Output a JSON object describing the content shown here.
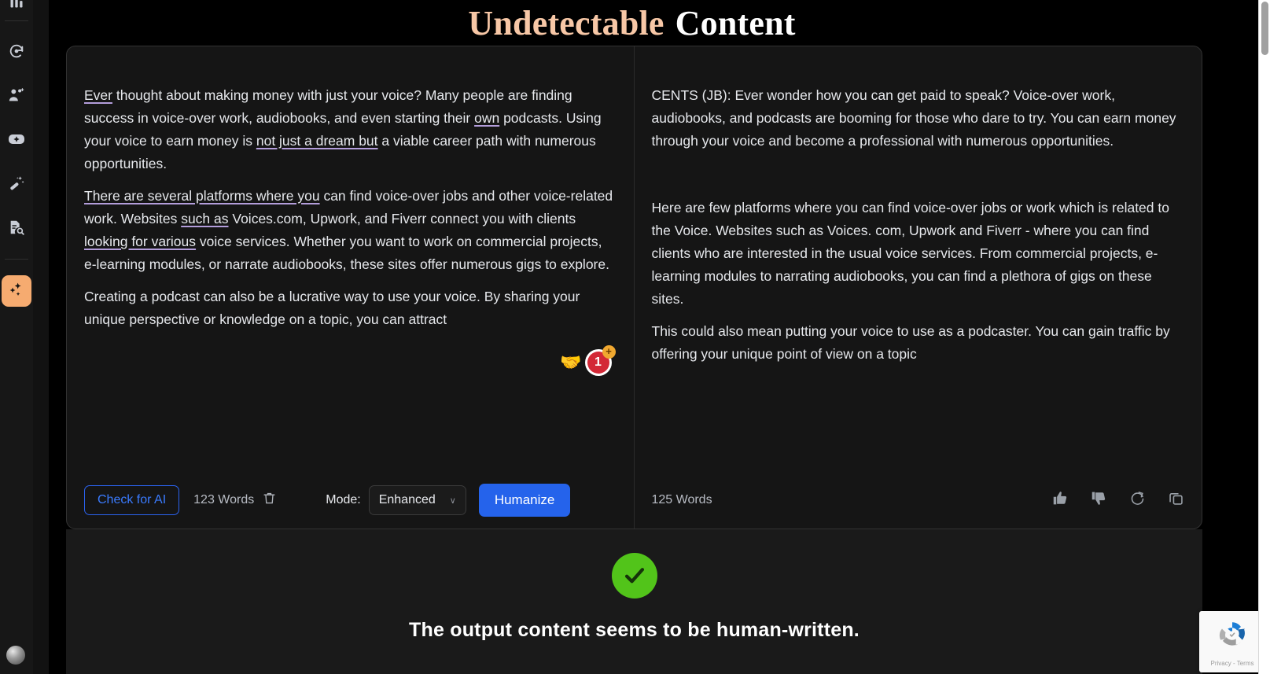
{
  "header": {
    "title_accent": "Undetectable",
    "title_plain": "Content"
  },
  "sidebar": {
    "items": [
      {
        "icon": "bar-chart-icon",
        "label": "Analytics"
      },
      {
        "icon": "rotate-sync-icon",
        "label": "Rewrite"
      },
      {
        "icon": "people-add-icon",
        "label": "Audience"
      },
      {
        "icon": "sparkle-box-icon",
        "label": "Generate"
      },
      {
        "icon": "magic-wand-icon",
        "label": "Magic Edit"
      },
      {
        "icon": "document-search-icon",
        "label": "AI Detector"
      }
    ],
    "active_item": {
      "icon": "sparkles-icon",
      "label": "Undetectable Content"
    },
    "avatar": {
      "icon": "avatar",
      "label": "Account"
    }
  },
  "editor": {
    "input_pane": {
      "paragraphs": [
        {
          "segments": [
            {
              "text": "Ever",
              "highlighted": true
            },
            {
              "text": " thought about making money with just your voice? Many people are finding success in voice-over work, audiobooks, and even starting their ",
              "highlighted": false
            },
            {
              "text": "own",
              "highlighted": true
            },
            {
              "text": " podcasts. Using your voice to earn money is ",
              "highlighted": false
            },
            {
              "text": "not just a dream but",
              "highlighted": true
            },
            {
              "text": " a viable career path with numerous opportunities.",
              "highlighted": false
            }
          ]
        },
        {
          "segments": [
            {
              "text": "There are several platforms where you",
              "highlighted": true
            },
            {
              "text": " can find voice-over jobs and other voice-related work. Websites ",
              "highlighted": false
            },
            {
              "text": "such as",
              "highlighted": true
            },
            {
              "text": " Voices.com, Upwork, and Fiverr connect you with clients ",
              "highlighted": false
            },
            {
              "text": "looking for various",
              "highlighted": true
            },
            {
              "text": " voice services. Whether you want to work on commercial projects, e-learning modules, or narrate audiobooks, these sites offer numerous gigs to explore.",
              "highlighted": false
            }
          ]
        },
        {
          "segments": [
            {
              "text": "Creating a podcast can also be a lucrative way to use your voice. By sharing your unique perspective or knowledge on a topic, you can attract",
              "highlighted": false
            }
          ]
        }
      ],
      "overlay": {
        "handshake_emoji": "🤝",
        "badge_count": "1",
        "badge_plus": "+"
      },
      "footer": {
        "check_for_ai_label": "Check for AI",
        "word_count": "123 Words",
        "trash_icon": "trash-icon",
        "mode_label": "Mode:",
        "mode_value": "Enhanced",
        "mode_chevron": "∨",
        "humanize_label": "Humanize"
      }
    },
    "output_pane": {
      "paragraphs": [
        "CENTS (JB): Ever wonder how you can get paid to speak? Voice-over work, audiobooks, and podcasts are booming for those who dare to try. You can earn money through your voice and become a professional with numerous opportunities.",
        "Here are few platforms where you can find voice-over jobs or work which is related to the Voice. Websites such as Voices. com, Upwork and Fiverr - where you can find clients who are interested in the usual voice services. From commercial projects, e-learning modules to narrating audiobooks, you can find a plethora of gigs on these sites.",
        "This could also mean putting your voice to use as a podcaster. You can gain traffic by offering your unique point of view on a topic"
      ],
      "footer": {
        "word_count": "125 Words",
        "actions": [
          {
            "icon": "thumbs-up-icon",
            "label": "Like"
          },
          {
            "icon": "thumbs-down-icon",
            "label": "Dislike"
          },
          {
            "icon": "regenerate-icon",
            "label": "Regenerate"
          },
          {
            "icon": "copy-icon",
            "label": "Copy"
          }
        ]
      }
    }
  },
  "result": {
    "icon": "green-check-icon",
    "message": "The output content seems to be human-written.",
    "accent_color": "#52c41a"
  },
  "recaptcha": {
    "icon": "recaptcha-icon",
    "legal": "Privacy - Terms"
  },
  "colors": {
    "brand_accent": "#f6ab70",
    "primary_button": "#2563eb",
    "check_ai_outline": "#2b63f0",
    "highlight_underline": "#b39ddb",
    "success": "#52c41a"
  }
}
